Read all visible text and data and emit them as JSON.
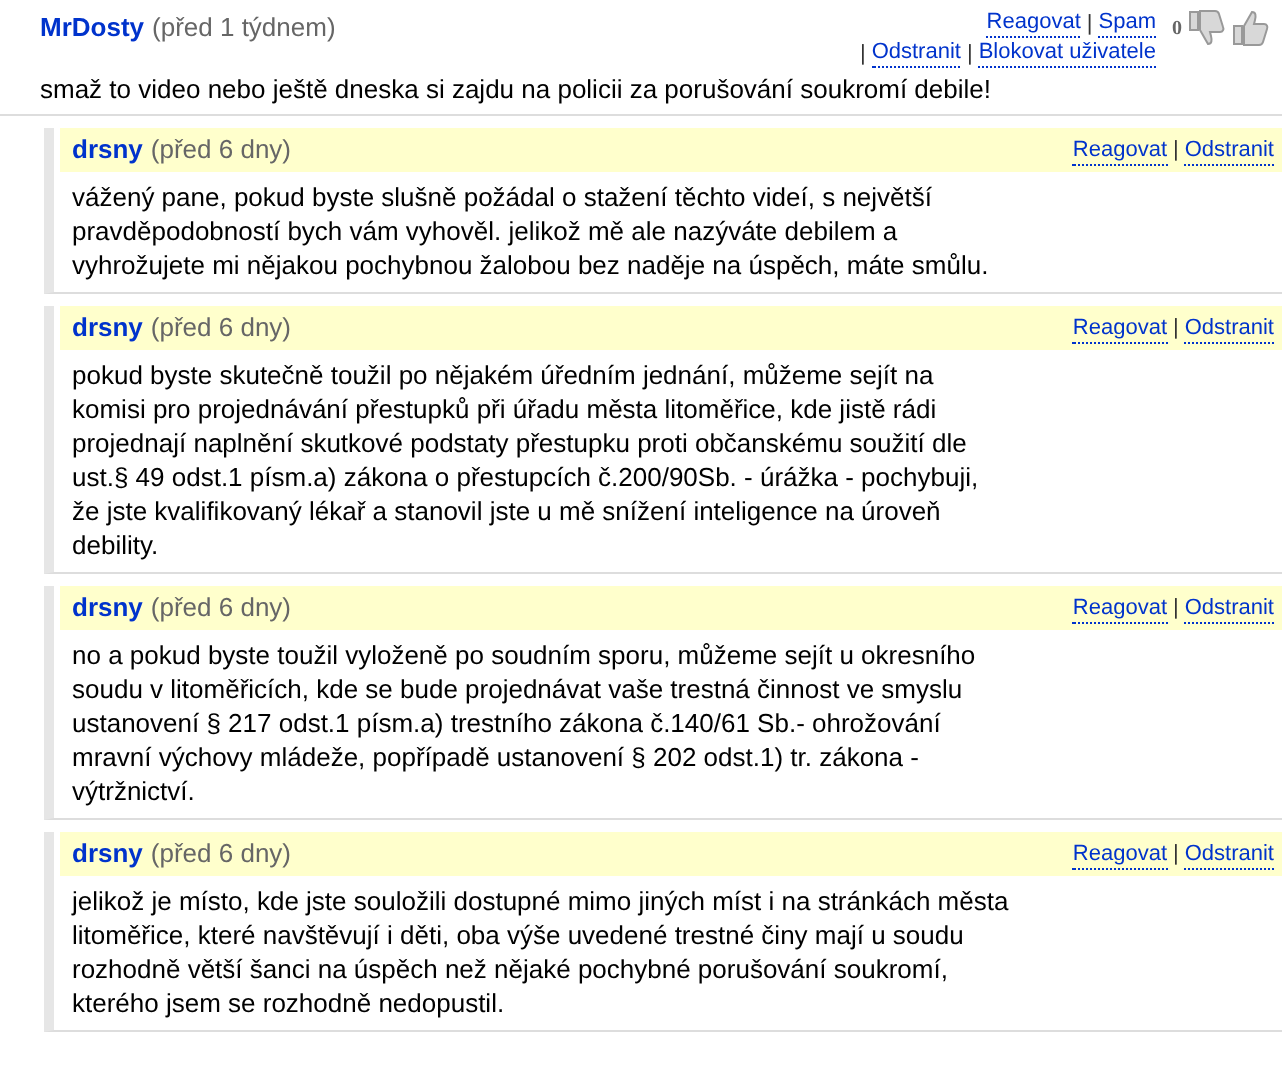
{
  "separator": "|",
  "comment": {
    "author": "MrDosty",
    "time": "(před 1 týdnem)",
    "action_rows": [
      {
        "leading_separator": false,
        "links": [
          "Reagovat",
          "Spam"
        ]
      },
      {
        "leading_separator": true,
        "links": [
          "Odstranit",
          "Blokovat uživatele"
        ]
      }
    ],
    "votes": "0",
    "text": "smaž to video nebo ještě dneska si zajdu na policii za porušování soukromí debile!"
  },
  "replies": [
    {
      "author": "drsny",
      "time": "(před 6 dny)",
      "links": [
        "Reagovat",
        "Odstranit"
      ],
      "text": "vážený pane, pokud byste slušně požádal o stažení těchto videí, s největší pravděpodobností bych vám vyhověl. jelikož mě ale nazýváte debilem a vyhrožujete mi nějakou pochybnou žalobou bez naděje na úspěch, máte smůlu."
    },
    {
      "author": "drsny",
      "time": "(před 6 dny)",
      "links": [
        "Reagovat",
        "Odstranit"
      ],
      "text": "pokud byste skutečně toužil po nějakém úředním jednání, můžeme sejít na komisi pro projednávání přestupků při úřadu města litoměřice, kde jistě rádi projednají naplnění skutkové podstaty přestupku proti občanskému soužití dle ust.§ 49 odst.1 písm.a) zákona o přestupcích č.200/90Sb. - úrážka - pochybuji, že jste kvalifikovaný lékař a stanovil jste u mě snížení inteligence na úroveň debility."
    },
    {
      "author": "drsny",
      "time": "(před 6 dny)",
      "links": [
        "Reagovat",
        "Odstranit"
      ],
      "text": "no a pokud byste toužil vyloženě po soudním sporu, můžeme sejít u okresního soudu v litoměřicích, kde se bude projednávat vaše trestná činnost ve smyslu ustanovení § 217 odst.1 písm.a) trestního zákona č.140/61 Sb.- ohrožování mravní výchovy mládeže, popřípadě ustanovení § 202 odst.1) tr. zákona - výtržnictví."
    },
    {
      "author": "drsny",
      "time": "(před 6 dny)",
      "links": [
        "Reagovat",
        "Odstranit"
      ],
      "text": "jelikož je místo, kde jste souložili dostupné mimo jiných míst i na stránkách města litoměřice, které navštěvují i děti, oba výše uvedené trestné činy mají u soudu rozhodně větší šanci na úspěch než nějaké pochybné porušování soukromí, kterého jsem se rozhodně nedopustil."
    }
  ]
}
